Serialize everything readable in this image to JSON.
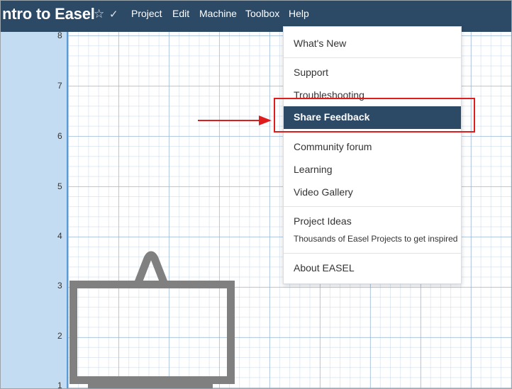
{
  "header": {
    "title": "ntro to Easel",
    "star_icon": "star-icon",
    "check_icon": "check-icon",
    "menu": [
      "Project",
      "Edit",
      "Machine",
      "Toolbox",
      "Help"
    ]
  },
  "canvas": {
    "y_ticks": [
      "8",
      "7",
      "6",
      "5",
      "4",
      "3",
      "2",
      "1"
    ]
  },
  "help_menu": {
    "whats_new": "What's New",
    "support": "Support",
    "troubleshooting": "Troubleshooting",
    "share_feedback": "Share Feedback",
    "community_forum": "Community forum",
    "learning": "Learning",
    "video_gallery": "Video Gallery",
    "project_ideas": "Project Ideas",
    "project_ideas_sub": "Thousands of Easel Projects to get inspired",
    "about": "About EASEL"
  },
  "colors": {
    "topbar": "#2c4a66",
    "highlight": "#2c4a66",
    "annotation": "#e01d1d",
    "rail": "#c3dcf2"
  }
}
